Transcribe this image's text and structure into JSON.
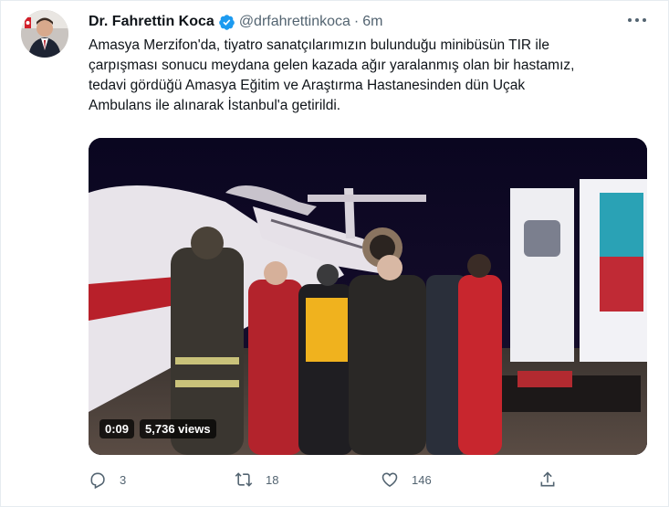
{
  "tweet": {
    "author_name": "Dr. Fahrettin Koca",
    "handle": "@drfahrettinkoca",
    "separator": "·",
    "time": "6m",
    "text_lines": [
      "Amasya Merzifon'da, tiyatro sanatçılarımızın bulunduğu minibüsün TIR ile",
      "çarpışması sonucu meydana gelen kazada ağır yaralanmış olan bir hastamız,",
      "tedavi gördüğü Amasya Eğitim ve Araştırma Hastanesinden dün Uçak",
      "Ambulans ile alınarak İstanbul'a getirildi."
    ],
    "video": {
      "duration": "0:09",
      "views": "5,736 views"
    },
    "actions": {
      "replies": "3",
      "retweets": "18",
      "likes": "146"
    },
    "colors": {
      "verified": "#1d9bf0",
      "secondary_text": "#536471"
    },
    "icons": [
      "verified-badge-icon",
      "more-icon",
      "reply-icon",
      "retweet-icon",
      "like-icon",
      "share-icon"
    ]
  }
}
